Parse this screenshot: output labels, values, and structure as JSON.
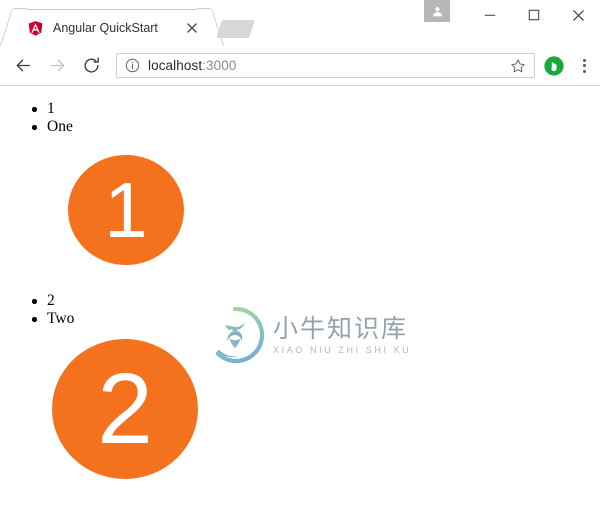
{
  "window": {
    "controls": {
      "profile_icon": "user-avatar-icon",
      "minimize_label": "—",
      "maximize_label": "□",
      "close_label": "✕"
    }
  },
  "tabs": {
    "active": {
      "title": "Angular QuickStart",
      "favicon": "angular-logo-icon",
      "close_label": "✕"
    },
    "new_tab_label": ""
  },
  "toolbar": {
    "back_icon": "back-arrow-icon",
    "forward_icon": "forward-arrow-icon",
    "reload_icon": "reload-icon",
    "security_icon": "info-circle-icon",
    "url_host": "localhost",
    "url_port": ":3000",
    "url_full": "localhost:3000",
    "bookmark_icon": "star-icon",
    "extension_icon": "green-hand-extension-icon",
    "menu_icon": "three-dot-menu-icon"
  },
  "page": {
    "background": "#ffffff",
    "accent_color": "#f4711e",
    "groups": [
      {
        "list": [
          "1",
          "One"
        ],
        "badge_text": "1"
      },
      {
        "list": [
          "2",
          "Two"
        ],
        "badge_text": "2"
      }
    ]
  },
  "watermark": {
    "logo_icon": "bull-head-circle-logo-icon",
    "title_cn": "小牛知识库",
    "title_en": "XIAO NIU ZHI SHI KU"
  }
}
